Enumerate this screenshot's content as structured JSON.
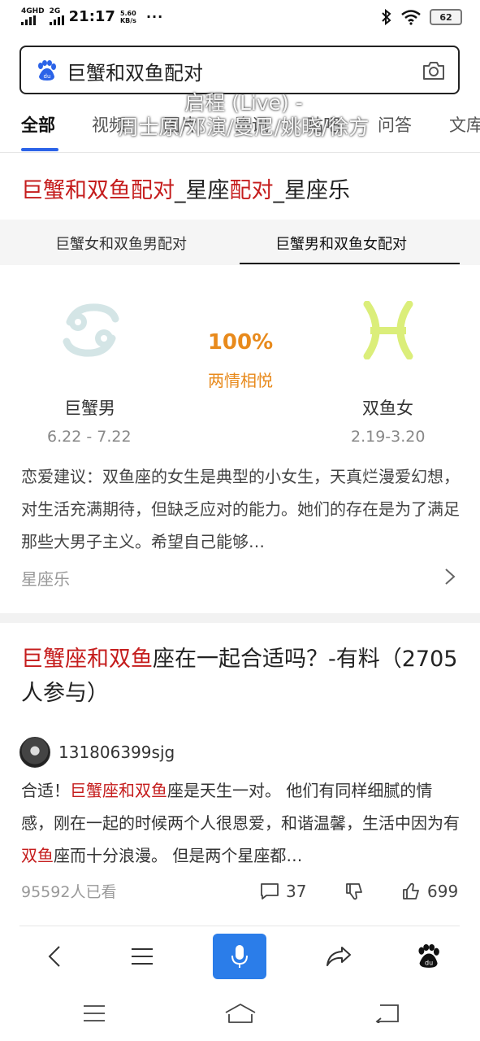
{
  "status_bar": {
    "signal1_label": "4GHD",
    "signal2_label": "2G",
    "time": "21:17",
    "speed_value": "5.60",
    "speed_unit": "KB/s",
    "more": "···",
    "battery": "62"
  },
  "search": {
    "query": "巨蟹和双鱼配对"
  },
  "tabs": [
    {
      "label": "全部"
    },
    {
      "label": "视频"
    },
    {
      "label": "图片"
    },
    {
      "label": "资讯"
    },
    {
      "label": "贴吧"
    },
    {
      "label": "问答"
    },
    {
      "label": "文库"
    }
  ],
  "overlay": {
    "line1": "启程 (Live) -",
    "line2": "周士原/邓演/曼尼/姚晓/徐方"
  },
  "card1": {
    "title_parts": [
      "巨蟹和双鱼配对",
      "_星座",
      "配对",
      "_星座乐"
    ],
    "subtabs": [
      "巨蟹女和双鱼男配对",
      "巨蟹男和双鱼女配对"
    ],
    "sign_left": {
      "name": "巨蟹男",
      "dates": "6.22 - 7.22",
      "color": "#d4e5e6"
    },
    "sign_right": {
      "name": "双鱼女",
      "dates": "2.19-3.20",
      "color": "#dbee7a"
    },
    "match_percent": "100%",
    "match_label": "两情相悦",
    "advice": "恋爱建议：双鱼座的女生是典型的小女生，天真烂漫爱幻想，对生活充满期待，但缺乏应对的能力。她们的存在是为了满足那些大男子主义。希望自己能够…",
    "source": "星座乐"
  },
  "card2": {
    "title_hl": "巨蟹座和双鱼",
    "title_rest": "座在一起合适吗？-有料（2705人参与）",
    "author": "131806399sjg",
    "body_prefix": "合适！",
    "body_hl1": "巨蟹座和双鱼",
    "body_mid": "座是天生一对。 他们有同样细腻的情感，刚在一起的时候两个人很恩爱，和谐温馨，生活中因为有",
    "body_hl2": "双鱼",
    "body_end": "座而十分浪漫。 但是两个星座都…",
    "views": "95592人已看",
    "comments": "37",
    "likes": "699"
  },
  "colors": {
    "accent": "#2b63e8",
    "highlight": "#c51d1d",
    "orange": "#e88a1c"
  }
}
